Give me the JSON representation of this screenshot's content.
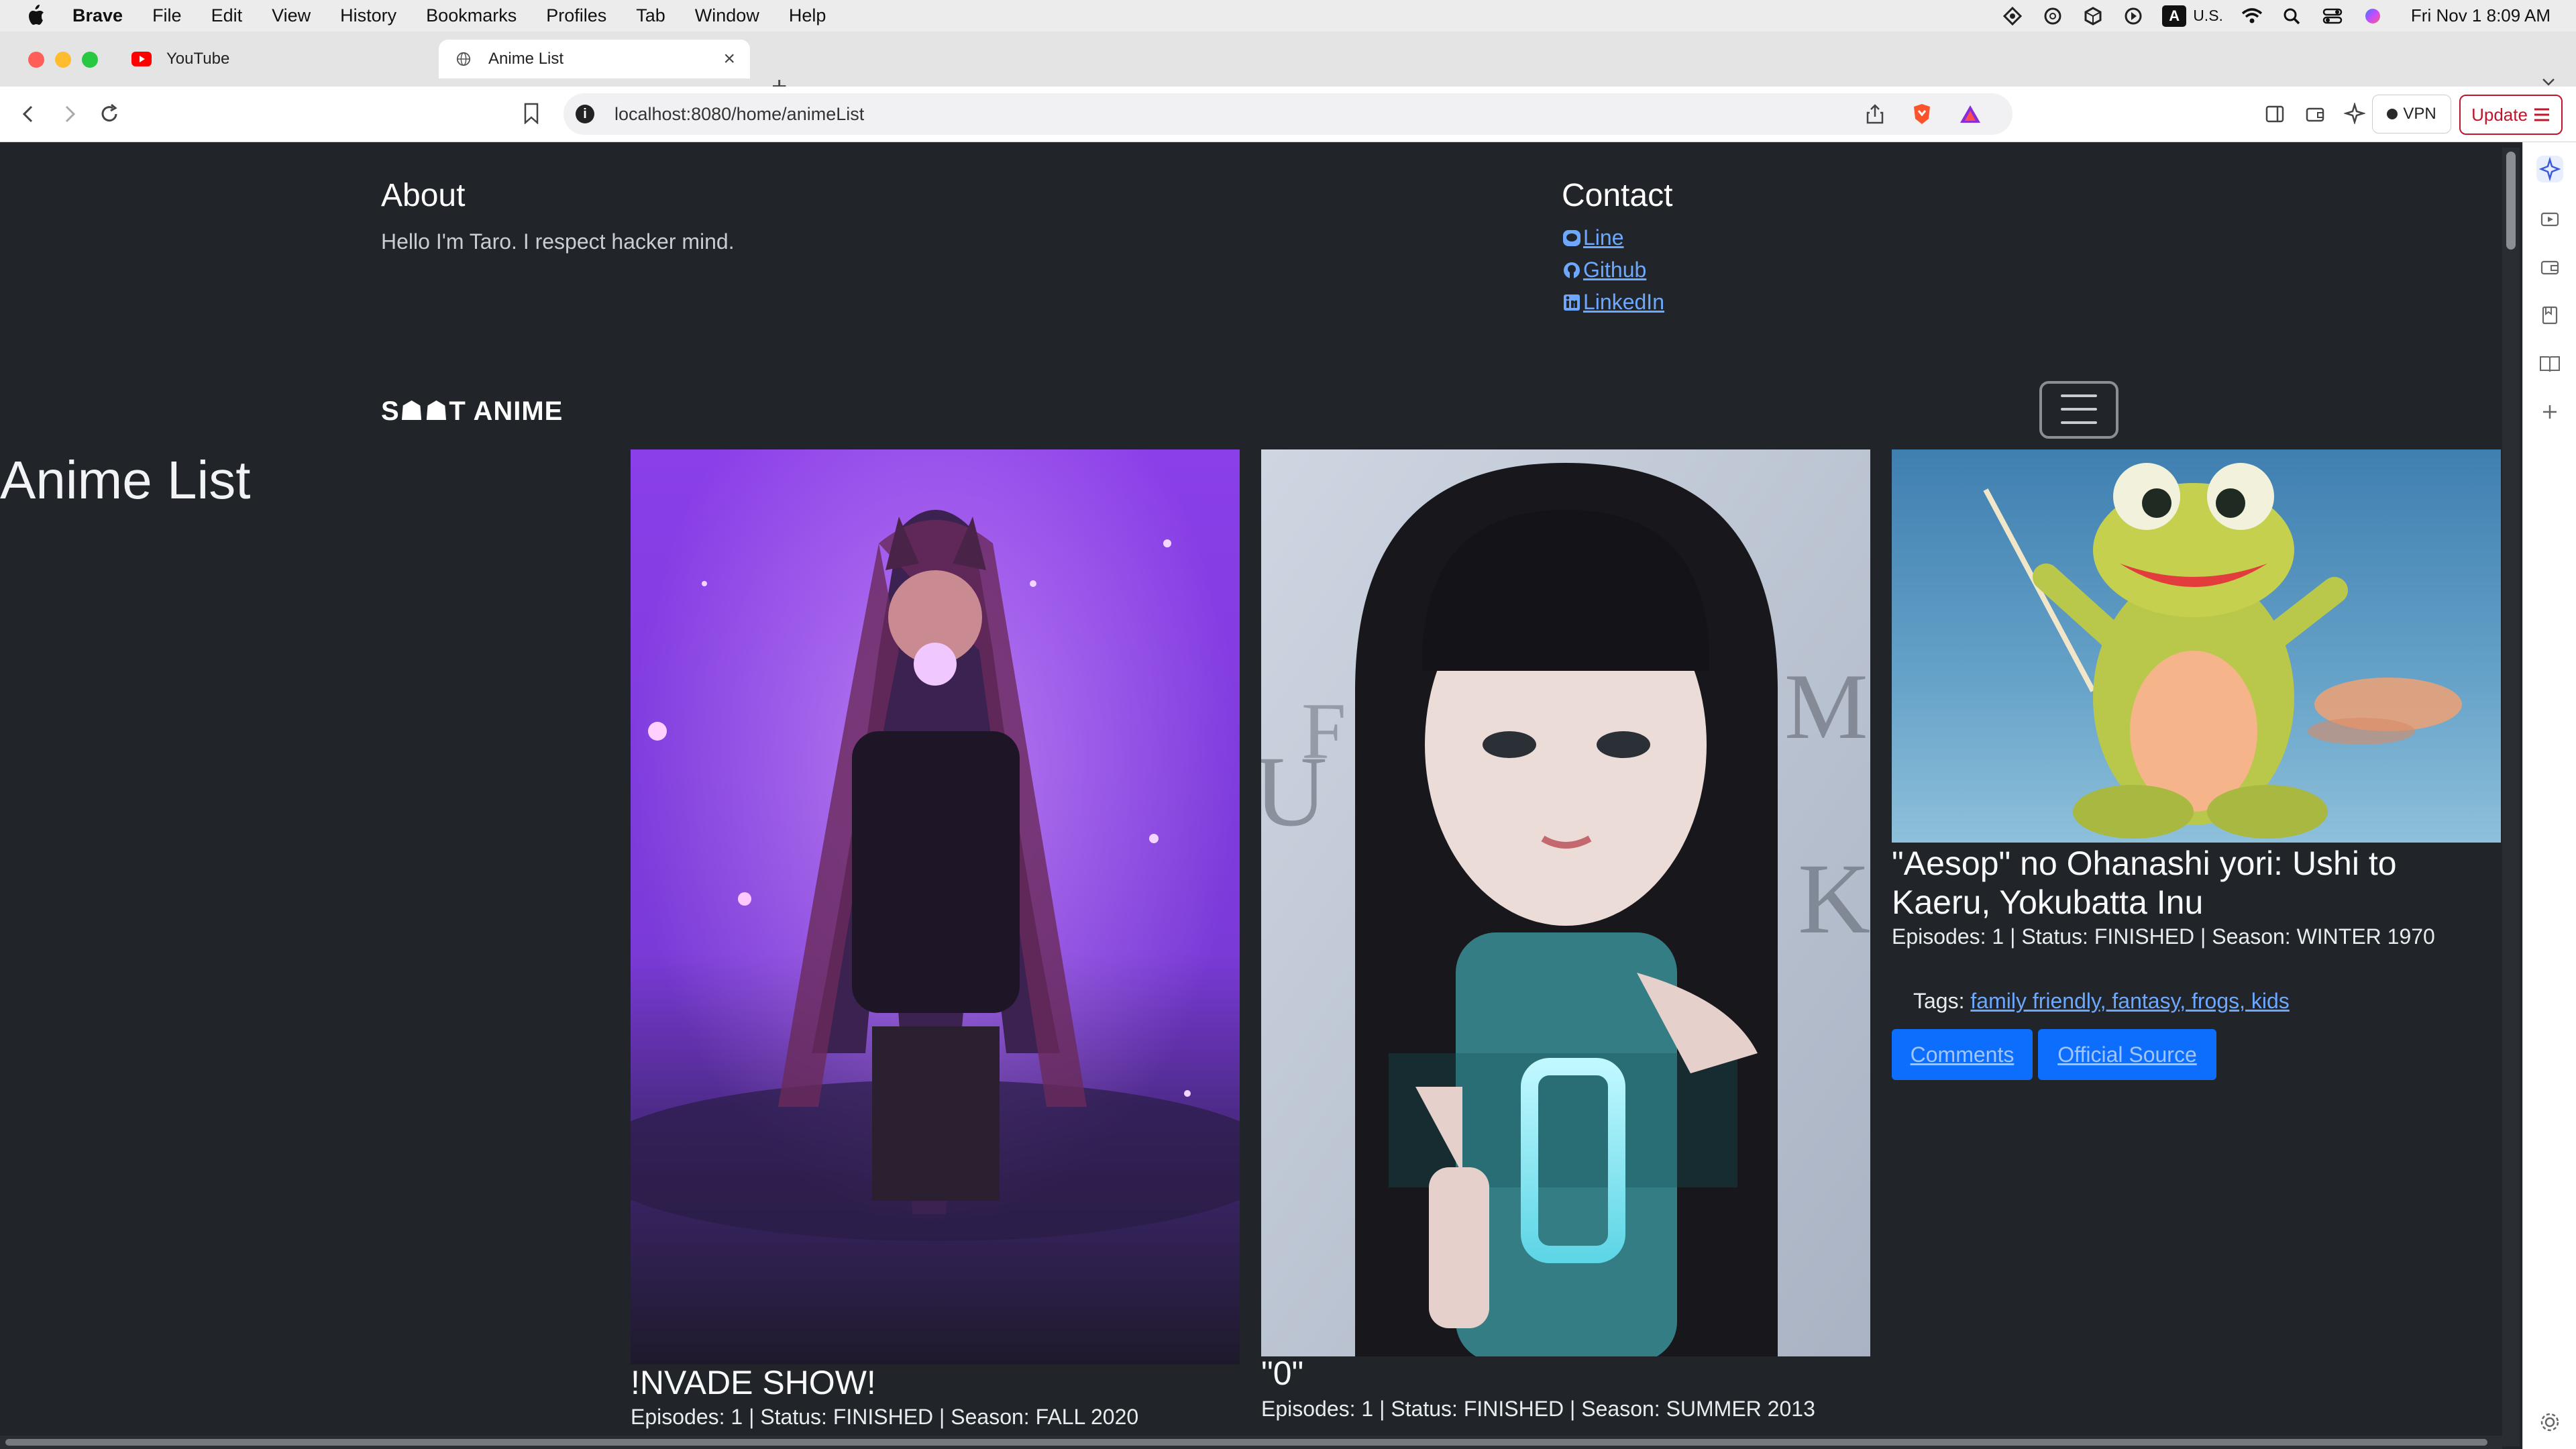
{
  "menubar": {
    "app_name": "Brave",
    "items": [
      "File",
      "Edit",
      "View",
      "History",
      "Bookmarks",
      "Profiles",
      "Tab",
      "Window",
      "Help"
    ],
    "input_source_letter": "A",
    "input_source_label": "U.S.",
    "clock": "Fri Nov 1  8:09 AM"
  },
  "tabs": [
    {
      "title": "YouTube",
      "icon": "youtube-icon",
      "active": false
    },
    {
      "title": "Anime List",
      "icon": "globe-icon",
      "active": true
    }
  ],
  "toolbar": {
    "url": "localhost:8080/home/animeList",
    "vpn_label": "VPN",
    "update_label": "Update"
  },
  "page": {
    "about": {
      "heading": "About",
      "text": "Hello I'm Taro. I respect hacker mind."
    },
    "contact": {
      "heading": "Contact",
      "links": [
        {
          "label": "Line",
          "icon": "line-icon"
        },
        {
          "label": "Github",
          "icon": "github-icon"
        },
        {
          "label": "LinkedIn",
          "icon": "linkedin-icon"
        }
      ]
    },
    "brand": "S☗☗T ANIME",
    "title": "Anime List",
    "cards": [
      {
        "title": "!NVADE SHOW!",
        "meta": "Episodes: 1 | Status: FINISHED | Season: FALL 2020"
      },
      {
        "title": "\"0\"",
        "meta": "Episodes: 1 | Status: FINISHED | Season: SUMMER 2013"
      },
      {
        "title": "\"Aesop\" no Ohanashi yori: Ushi to Kaeru, Yokubatta Inu",
        "meta": "Episodes: 1 | Status: FINISHED | Season: WINTER 1970",
        "tags_label": "Tags:",
        "tags": "family friendly, fantasy, frogs, kids",
        "buttons": [
          "Comments",
          "Official Source"
        ]
      }
    ]
  },
  "colors": {
    "page_bg": "#212529",
    "link": "#6ea8fe",
    "button": "#0d6efd",
    "update_red": "#c0152b"
  }
}
